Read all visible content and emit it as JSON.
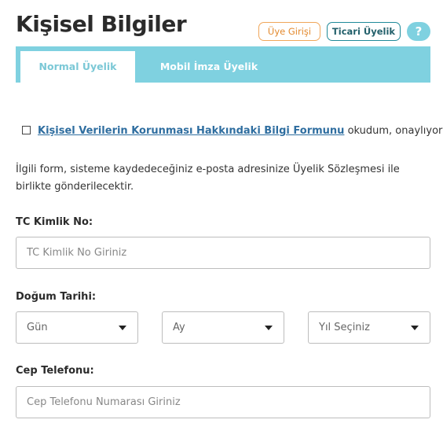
{
  "header": {
    "title": "Kişisel Bilgiler",
    "login_button": "Üye Girişi",
    "corporate_button": "Ticari Üyelik",
    "help_label": "?"
  },
  "tabs": [
    {
      "label": "Normal Üyelik",
      "active": true
    },
    {
      "label": "Mobil İmza Üyelik",
      "active": false
    }
  ],
  "consent": {
    "checked": false,
    "link_text": "Kişisel Verilerin Korunması Hakkındaki Bilgi Formunu",
    "suffix_text": " okudum, onaylıyorum."
  },
  "info_text": "İlgili form, sisteme kaydedeceğiniz e-posta adresinize Üyelik Sözleşmesi ile birlikte gönderilecektir.",
  "form": {
    "tc": {
      "label": "TC Kimlik No:",
      "value": "",
      "placeholder": "TC Kimlik No Giriniz"
    },
    "birth": {
      "label": "Doğum Tarihi:",
      "day": "Gün",
      "month": "Ay",
      "year": "Yıl Seçiniz"
    },
    "phone": {
      "label": "Cep Telefonu:",
      "value": "",
      "placeholder": "Cep Telefonu Numarası Giriniz"
    }
  },
  "colors": {
    "accent": "#7fd1e0",
    "login_border": "#f0a65a",
    "corporate_border": "#1f8a99",
    "link": "#2f6ea0"
  }
}
